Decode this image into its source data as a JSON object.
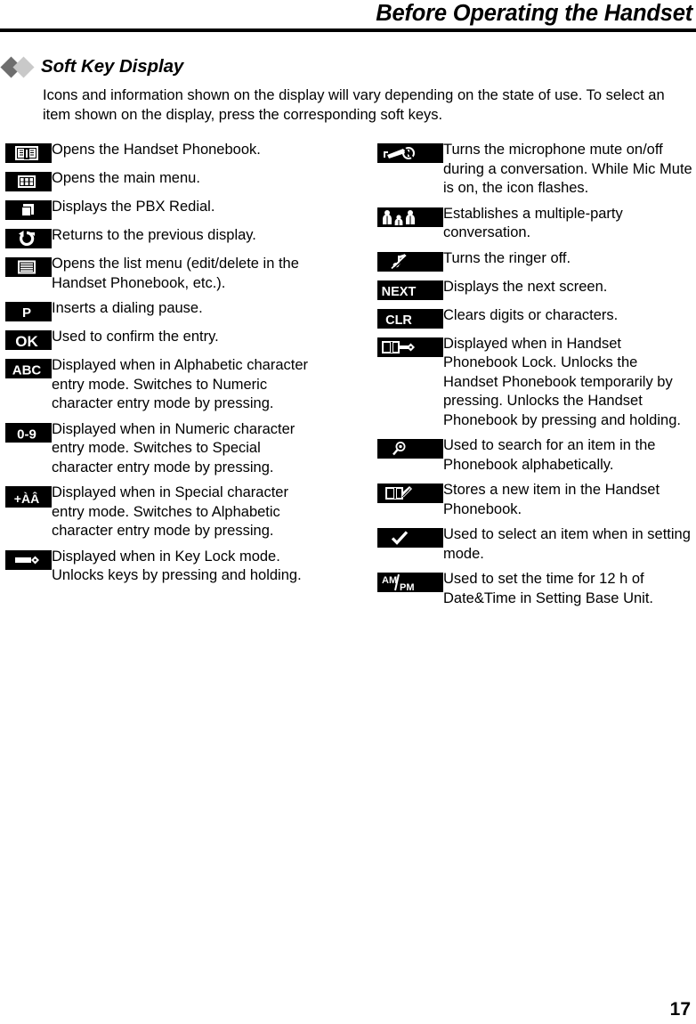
{
  "header": {
    "title": "Before Operating the Handset"
  },
  "section": {
    "title": "Soft Key Display",
    "intro": "Icons and information shown on the display will vary depending on the state of use. To select an item shown on the display, press the corresponding soft keys."
  },
  "left_column": [
    {
      "icon": "phonebook-open-icon",
      "description": "Opens the Handset Phonebook."
    },
    {
      "icon": "main-menu-grid-icon",
      "description": "Opens the main menu."
    },
    {
      "icon": "pbx-redial-icon",
      "description": "Displays the PBX Redial."
    },
    {
      "icon": "return-previous-icon",
      "description": "Returns to the previous display."
    },
    {
      "icon": "list-menu-icon",
      "description": "Opens the list menu (edit/delete in the Handset Phonebook, etc.)."
    },
    {
      "icon": "pause-p-icon",
      "label": "P",
      "description": "Inserts a dialing pause."
    },
    {
      "icon": "ok-icon",
      "label": "OK",
      "description": "Used to confirm the entry."
    },
    {
      "icon": "abc-icon",
      "label": "ABC",
      "description": "Displayed when in Alphabetic character entry mode. Switches to Numeric character entry mode by pressing."
    },
    {
      "icon": "numeric-0-9-icon",
      "label": "0-9",
      "description": "Displayed when in Numeric character entry mode. Switches to Special character entry mode by pressing."
    },
    {
      "icon": "special-chars-icon",
      "label": "+ÀÂ",
      "description": "Displayed when in Special character entry mode. Switches to Alphabetic character entry mode by pressing."
    },
    {
      "icon": "key-lock-icon",
      "description": "Displayed when in Key Lock mode. Unlocks keys by pressing and holding."
    }
  ],
  "right_column": [
    {
      "icon": "mic-mute-icon",
      "description": "Turns the microphone mute on/off during a conversation. While Mic Mute is on, the icon flashes."
    },
    {
      "icon": "multi-party-icon",
      "description": "Establishes a multiple-party conversation."
    },
    {
      "icon": "ringer-off-icon",
      "description": "Turns the ringer off."
    },
    {
      "icon": "next-icon",
      "label": "NEXT",
      "description": "Displays the next screen."
    },
    {
      "icon": "clear-icon",
      "label": "CLR",
      "description": "Clears digits or characters."
    },
    {
      "icon": "phonebook-lock-icon",
      "description": "Displayed when in Handset Phonebook Lock. Unlocks the Handset Phonebook temporarily by pressing. Unlocks the Handset Phonebook by pressing and holding."
    },
    {
      "icon": "search-magnifier-icon",
      "description": "Used to search for an item in the Phonebook alphabetically."
    },
    {
      "icon": "phonebook-store-icon",
      "description": "Stores a new item in the Handset Phonebook."
    },
    {
      "icon": "checkmark-select-icon",
      "description": "Used to select an item when in setting mode."
    },
    {
      "icon": "am-pm-icon",
      "label": "AM/PM",
      "description": "Used to set the time for 12 h of Date&Time in Setting Base Unit."
    }
  ],
  "footer": {
    "page_number": "17"
  }
}
